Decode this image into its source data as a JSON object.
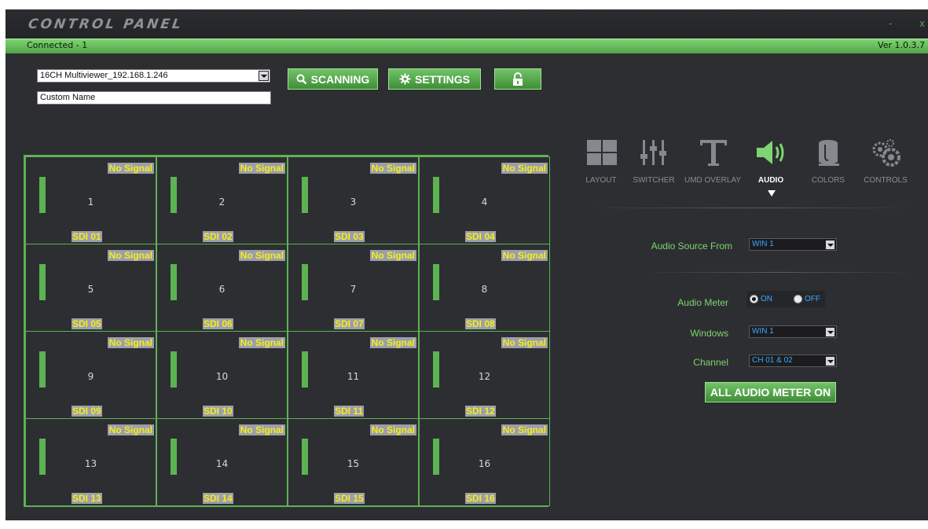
{
  "window": {
    "title": "CONTROL PANEL",
    "minimize_label": "-",
    "close_label": "x"
  },
  "status": {
    "text": "Connected - 1",
    "version": "Ver 1.0.3.7"
  },
  "toolbar": {
    "device_select": "16CH Multiviewer_192.168.1.246",
    "custom_name": "Custom Name",
    "scan_label": "SCANNING",
    "settings_label": "SETTINGS"
  },
  "grid": {
    "cells": [
      {
        "number": "1",
        "status": "No Signal",
        "source": "SDI 01"
      },
      {
        "number": "2",
        "status": "No Signal",
        "source": "SDI 02"
      },
      {
        "number": "3",
        "status": "No Signal",
        "source": "SDI 03"
      },
      {
        "number": "4",
        "status": "No Signal",
        "source": "SDI 04"
      },
      {
        "number": "5",
        "status": "No Signal",
        "source": "SDI 05"
      },
      {
        "number": "6",
        "status": "No Signal",
        "source": "SDI 06"
      },
      {
        "number": "7",
        "status": "No Signal",
        "source": "SDI 07"
      },
      {
        "number": "8",
        "status": "No Signal",
        "source": "SDI 08"
      },
      {
        "number": "9",
        "status": "No Signal",
        "source": "SDI 09"
      },
      {
        "number": "10",
        "status": "No Signal",
        "source": "SDI 10"
      },
      {
        "number": "11",
        "status": "No Signal",
        "source": "SDI 11"
      },
      {
        "number": "12",
        "status": "No Signal",
        "source": "SDI 12"
      },
      {
        "number": "13",
        "status": "No Signal",
        "source": "SDI 13"
      },
      {
        "number": "14",
        "status": "No Signal",
        "source": "SDI 14"
      },
      {
        "number": "15",
        "status": "No Signal",
        "source": "SDI 15"
      },
      {
        "number": "16",
        "status": "No Signal",
        "source": "SDI 16"
      }
    ]
  },
  "tabs": [
    {
      "label": "LAYOUT",
      "icon": "layout-icon"
    },
    {
      "label": "SWITCHER",
      "icon": "sliders-icon"
    },
    {
      "label": "UMD OVERLAY",
      "icon": "text-icon"
    },
    {
      "label": "AUDIO",
      "icon": "speaker-icon",
      "active": true
    },
    {
      "label": "COLORS",
      "icon": "paint-bucket-icon"
    },
    {
      "label": "CONTROLS",
      "icon": "gears-icon"
    }
  ],
  "audio": {
    "source_label": "Audio Source From",
    "source_value": "WIN 1",
    "meter_label": "Audio Meter",
    "meter_on": "ON",
    "meter_off": "OFF",
    "meter_selected": "ON",
    "windows_label": "Windows",
    "windows_value": "WIN 1",
    "channel_label": "Channel",
    "channel_value": "CH 01 & 02",
    "all_meter_button": "ALL AUDIO METER ON"
  },
  "colors": {
    "accent_green": "#5cb352",
    "label_green": "#7ed472",
    "panel_bg": "#2d2e31",
    "highlight_yellow": "#f4ee18",
    "value_blue": "#3aa7ff"
  }
}
